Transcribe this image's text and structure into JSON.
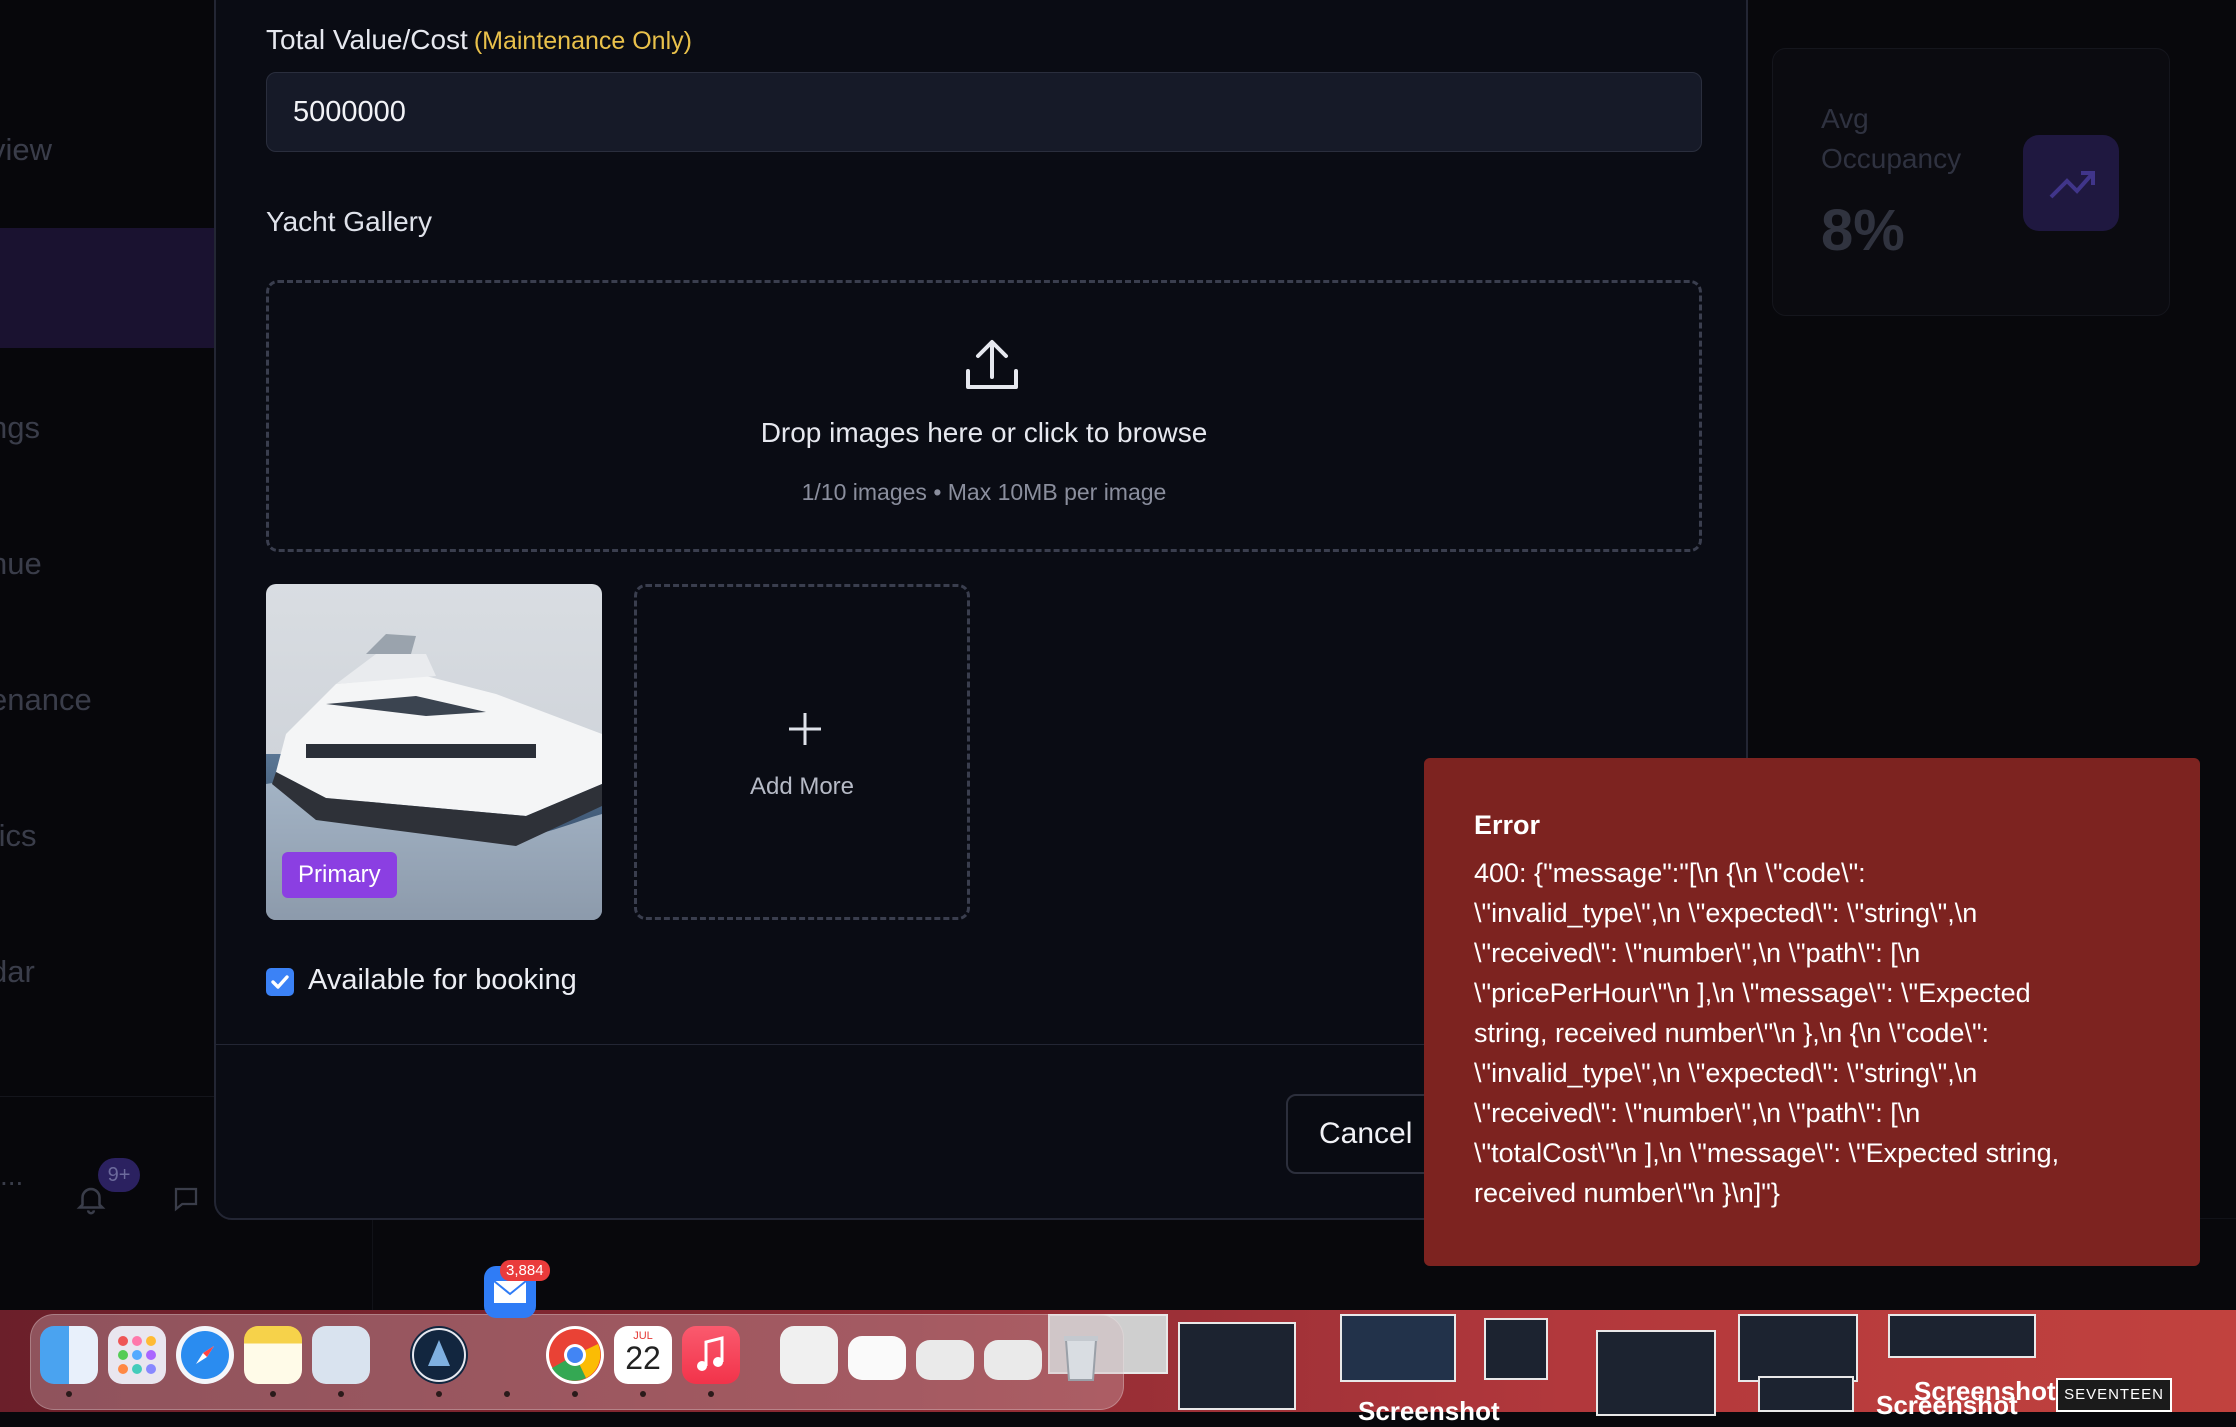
{
  "background": {
    "sidebar_items": [
      "view",
      "ngs",
      "nue",
      "enance",
      "tics",
      "dar"
    ],
    "sidebar_more": "...",
    "notifications_badge": "9+",
    "stat_card": {
      "label": "Avg Occupancy",
      "value": "8%"
    }
  },
  "modal": {
    "total_value_label": "Total Value/Cost",
    "total_value_hint": "(Maintenance Only)",
    "total_value": "5000000",
    "gallery_label": "Yacht Gallery",
    "dropzone_title": "Drop images here or click to browse",
    "dropzone_sub": "1/10 images • Max 10MB per image",
    "primary_badge": "Primary",
    "add_more_label": "Add More",
    "available_label": "Available for booking",
    "available_checked": true,
    "cancel_label": "Cancel"
  },
  "toast": {
    "title": "Error",
    "message": "400: {\"message\":\"[\\n {\\n \\\"code\\\":\n\\\"invalid_type\\\",\\n \\\"expected\\\": \\\"string\\\",\\n\n\\\"received\\\": \\\"number\\\",\\n \\\"path\\\": [\\n\n\\\"pricePerHour\\\"\\n ],\\n \\\"message\\\": \\\"Expected\nstring, received number\\\"\\n },\\n {\\n \\\"code\\\":\n\\\"invalid_type\\\",\\n \\\"expected\\\": \\\"string\\\",\\n\n\\\"received\\\": \\\"number\\\",\\n \\\"path\\\": [\\n\n\\\"totalCost\\\"\\n ],\\n \\\"message\\\": \\\"Expected string,\nreceived number\\\"\\n }\\n]\"}"
  },
  "dock": {
    "mail_badge": "3,884",
    "calendar_month": "JUL",
    "calendar_day": "22",
    "apps": [
      "finder-icon",
      "launchpad-icon",
      "safari-icon",
      "notes-icon",
      "preview-icon",
      "app-icon",
      "chrome-icon",
      "calendar-icon",
      "music-icon",
      "pdf-doc-icon",
      "calendar-doc-icon",
      "folder-icon",
      "folder-icon",
      "trash-icon"
    ],
    "desktop_captions": [
      "Screenshot",
      "Screenshot",
      "Screenshot"
    ],
    "seventeen_label": "SEVENTEEN"
  },
  "colors": {
    "accent": "#8b3fe2",
    "error": "#7d2320",
    "hint": "#e9c14b",
    "checkbox": "#3b82f6"
  }
}
